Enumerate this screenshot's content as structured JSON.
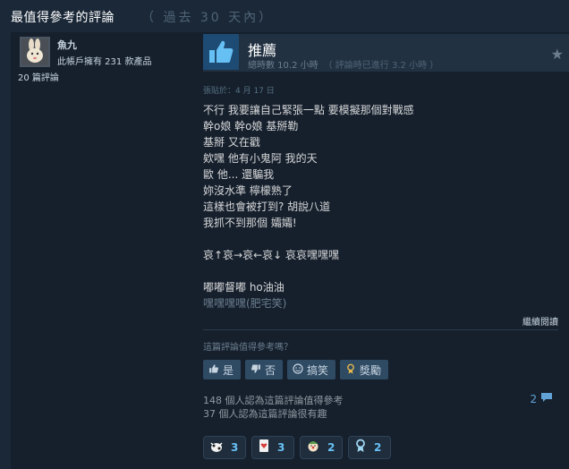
{
  "header": {
    "title": "最值得參考的評論",
    "subtitle": "（ 過去 30 天內）"
  },
  "author": {
    "name": "魚九",
    "owned": "此帳戶擁有 231 款產品",
    "reviews": "20 篇評論"
  },
  "review": {
    "verdict": "推薦",
    "hours": "總時數 10.2 小時",
    "hours_at_review": "（ 評論時已進行 3.2 小時 ）",
    "posted": "張貼於：4 月 17 日",
    "lines": [
      "不行 我要讓自己緊張一點 要模擬那個對戰感",
      "幹o娘 幹o娘 基掰勒",
      "基掰 又在戳",
      "欸嘿 他有小鬼阿 我的天",
      "歐 他... 還騙我",
      "妳沒水準 檸檬熟了",
      "這樣也會被打到? 胡說八道",
      "我抓不到那個 孀孀!",
      "",
      "哀↑哀→哀←哀↓ 哀哀嘿嘿嘿",
      "",
      "嘟嘟督嘟 ho油油"
    ],
    "faded_line": "嘿嘿嘿嘿(肥宅笑)",
    "read_more": "繼續閱讀"
  },
  "helpful": {
    "question": "這篇評論值得參考嗎？",
    "yes": "是",
    "no": "否",
    "funny": "搞笑",
    "award": "獎勵"
  },
  "stats": {
    "helpful": "148 個人認為這篇評論值得參考",
    "funny": "37 個人認為這篇評論很有趣"
  },
  "comments": {
    "count": "2"
  },
  "awards": [
    {
      "icon": "cow-icon",
      "count": "3"
    },
    {
      "icon": "heart-card-icon",
      "count": "3"
    },
    {
      "icon": "clown-icon",
      "count": "2"
    },
    {
      "icon": "medal-icon",
      "count": "2"
    }
  ]
}
